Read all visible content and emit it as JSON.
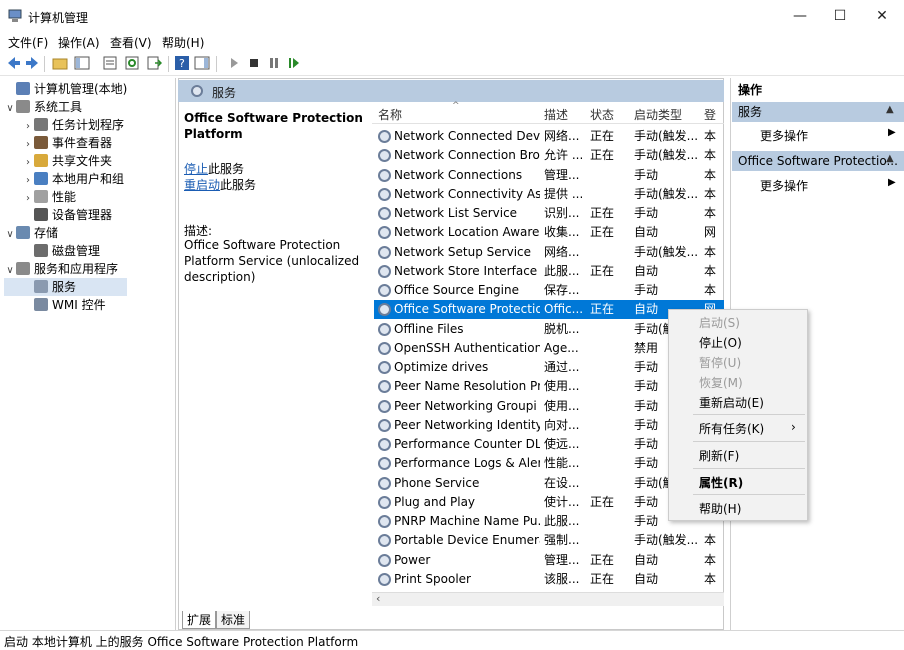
{
  "window": {
    "title": "计算机管理",
    "min": "—",
    "max": "☐",
    "close": "✕"
  },
  "menu": [
    "文件(F)",
    "操作(A)",
    "查看(V)",
    "帮助(H)"
  ],
  "tree": [
    {
      "label": "计算机管理(本地)",
      "exp": "",
      "indent": 0,
      "color": "#5b7fb5"
    },
    {
      "label": "系统工具",
      "exp": "∨",
      "indent": 0,
      "color": "#8a8a8a"
    },
    {
      "label": "任务计划程序",
      "exp": "›",
      "indent": 1,
      "color": "#777"
    },
    {
      "label": "事件查看器",
      "exp": "›",
      "indent": 1,
      "color": "#7a5a3a"
    },
    {
      "label": "共享文件夹",
      "exp": "›",
      "indent": 1,
      "color": "#d8a93b"
    },
    {
      "label": "本地用户和组",
      "exp": "›",
      "indent": 1,
      "color": "#4a7fc1"
    },
    {
      "label": "性能",
      "exp": "›",
      "indent": 1,
      "color": "#a0a0a0"
    },
    {
      "label": "设备管理器",
      "exp": "",
      "indent": 1,
      "color": "#555"
    },
    {
      "label": "存储",
      "exp": "∨",
      "indent": 0,
      "color": "#6a8ab0"
    },
    {
      "label": "磁盘管理",
      "exp": "",
      "indent": 1,
      "color": "#6c6c6c"
    },
    {
      "label": "服务和应用程序",
      "exp": "∨",
      "indent": 0,
      "color": "#8a8a8a"
    },
    {
      "label": "服务",
      "exp": "",
      "indent": 1,
      "color": "#8a9ab0"
    },
    {
      "label": "WMI 控件",
      "exp": "",
      "indent": 1,
      "color": "#7a8aa0"
    }
  ],
  "services": {
    "header": "服务",
    "detail_title": "Office Software Protection Platform",
    "stop_link": "停止",
    "stop_rest": "此服务",
    "restart_link": "重启动",
    "restart_rest": "此服务",
    "desc_label": "描述:",
    "desc_text": "Office Software Protection Platform Service (unlocalized description)",
    "columns": [
      "名称",
      "描述",
      "状态",
      "启动类型",
      "登"
    ],
    "rows": [
      [
        "Network Connected Devi...",
        "网络...",
        "正在",
        "手动(触发...",
        "本"
      ],
      [
        "Network Connection Bro",
        "允许 ...",
        "正在",
        "手动(触发...",
        "本"
      ],
      [
        "Network Connections",
        "管理...",
        "",
        "手动",
        "本"
      ],
      [
        "Network Connectivity Ass...",
        "提供 ...",
        "",
        "手动(触发...",
        "本"
      ],
      [
        "Network List Service",
        "识别...",
        "正在",
        "手动",
        "本"
      ],
      [
        "Network Location Aware...",
        "收集...",
        "正在",
        "自动",
        "网"
      ],
      [
        "Network Setup Service",
        "网络...",
        "",
        "手动(触发...",
        "本"
      ],
      [
        "Network Store Interface ...",
        "此服...",
        "正在",
        "自动",
        "本"
      ],
      [
        "Office  Source Engine",
        "保存...",
        "",
        "手动",
        "本"
      ],
      [
        "Office Software Protectio...",
        "Offic...",
        "正在",
        "自动",
        "网"
      ],
      [
        "Offline Files",
        "脱机...",
        "",
        "手动(触",
        ""
      ],
      [
        "OpenSSH Authentication ...",
        "Age...",
        "",
        "禁用",
        ""
      ],
      [
        "Optimize drives",
        "通过...",
        "",
        "手动",
        ""
      ],
      [
        "Peer Name Resolution Pr...",
        "使用...",
        "",
        "手动",
        ""
      ],
      [
        "Peer Networking Groupi",
        "使用...",
        "",
        "手动",
        ""
      ],
      [
        "Peer Networking Identity...",
        "向对...",
        "",
        "手动",
        ""
      ],
      [
        "Performance Counter DL...",
        "使远...",
        "",
        "手动",
        ""
      ],
      [
        "Performance Logs & Aler",
        "性能...",
        "",
        "手动",
        ""
      ],
      [
        "Phone Service",
        "在设...",
        "",
        "手动(触",
        ""
      ],
      [
        "Plug and Play",
        "使计...",
        "正在",
        "手动",
        ""
      ],
      [
        "PNRP Machine Name Pu...",
        "此服...",
        "",
        "手动",
        ""
      ],
      [
        "Portable Device Enumera...",
        "强制...",
        "",
        "手动(触发...",
        "本"
      ],
      [
        "Power",
        "管理...",
        "正在",
        "自动",
        "本"
      ],
      [
        "Print Spooler",
        "该服...",
        "正在",
        "自动",
        "本"
      ]
    ],
    "selected_index": 9,
    "tabs": [
      "扩展",
      "标准"
    ]
  },
  "actions": {
    "title": "操作",
    "section1": "服务",
    "more1": "更多操作",
    "section2": "Office Software Protectio...",
    "more2": "更多操作"
  },
  "context_menu": [
    {
      "label": "启动(S)",
      "disabled": true
    },
    {
      "label": "停止(O)",
      "disabled": false
    },
    {
      "label": "暂停(U)",
      "disabled": true
    },
    {
      "label": "恢复(M)",
      "disabled": true
    },
    {
      "label": "重新启动(E)",
      "disabled": false
    },
    {
      "label": "所有任务(K)",
      "disabled": false,
      "submenu": "›"
    },
    {
      "label": "刷新(F)",
      "disabled": false
    },
    {
      "label": "属性(R)",
      "disabled": false,
      "bold": true
    },
    {
      "label": "帮助(H)",
      "disabled": false
    }
  ],
  "status": "启动 本地计算机 上的服务 Office Software Protection Platform"
}
